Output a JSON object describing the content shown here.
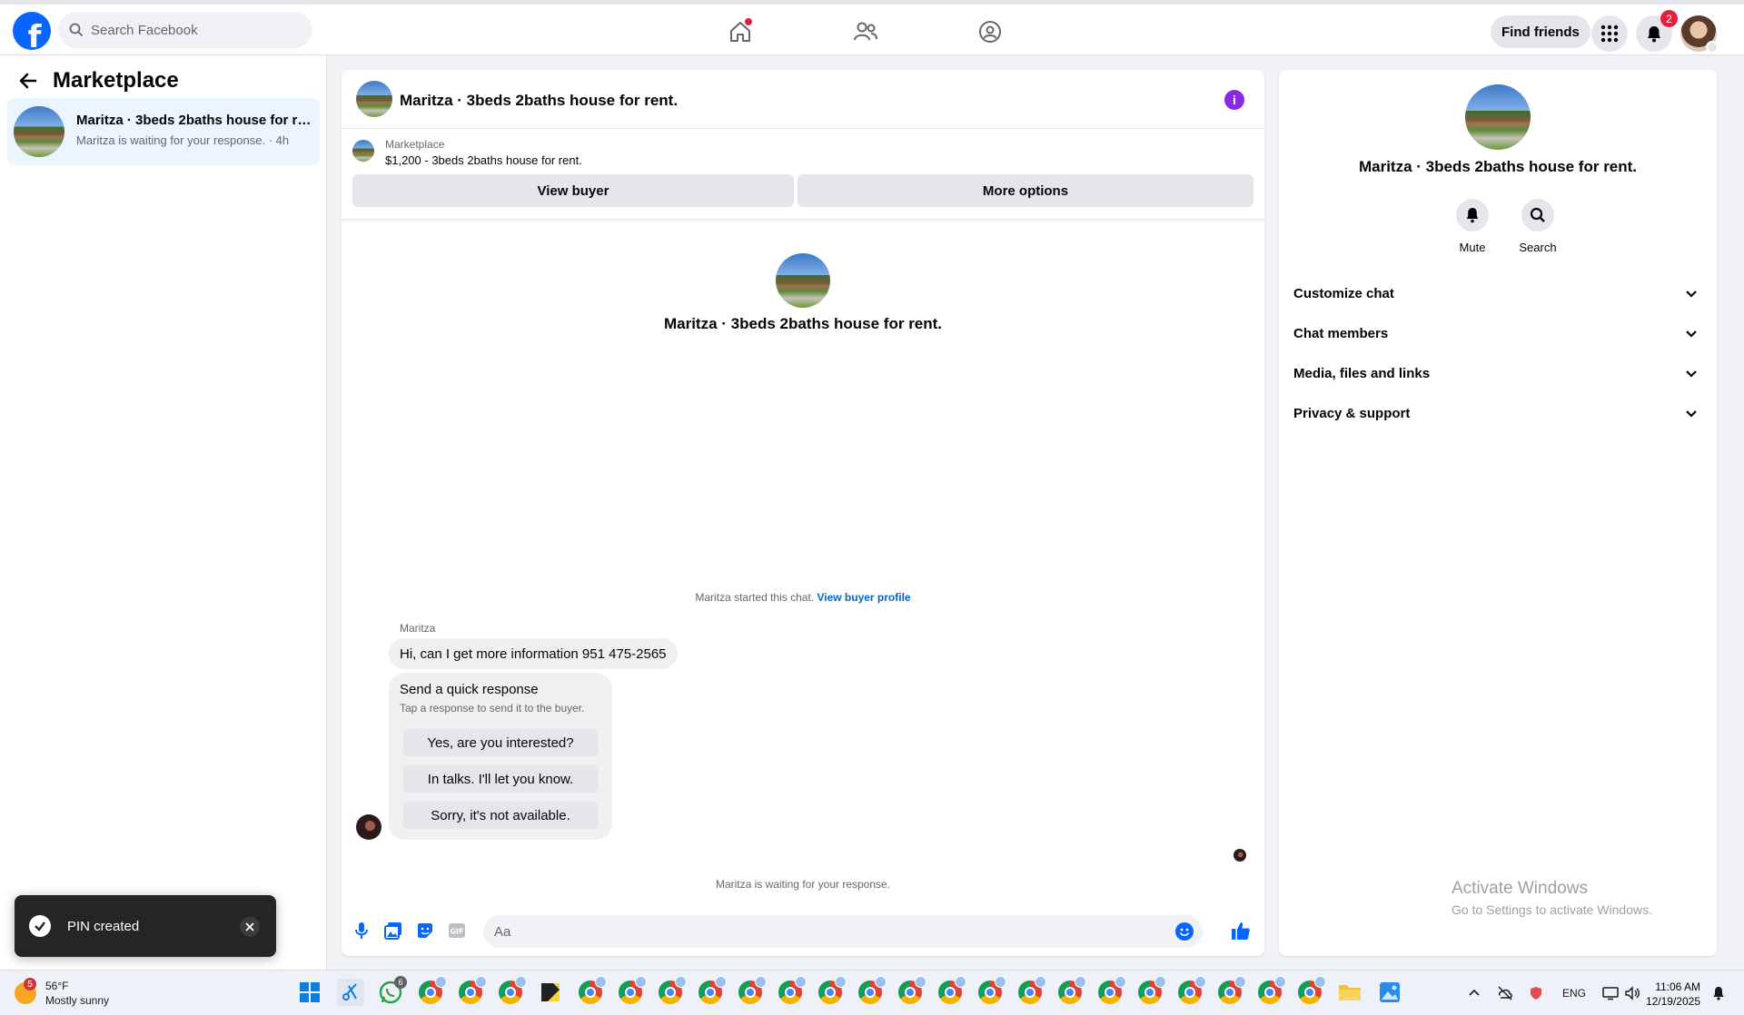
{
  "topbar": {
    "logo": "f",
    "search_placeholder": "Search Facebook",
    "find_friends": "Find friends",
    "notifications_count": "2",
    "nav_icons": [
      "home-icon",
      "friends-icon",
      "groups-icon"
    ]
  },
  "sidebar": {
    "title": "Marketplace",
    "threads": [
      {
        "title": "Maritza · 3beds 2baths house for rent.",
        "subtitle": "Maritza is waiting for your response. · 4h"
      }
    ]
  },
  "toast": {
    "message": "PIN created"
  },
  "chat": {
    "header_name": "Maritza · 3beds 2baths house for rent.",
    "marketplace": {
      "source": "Marketplace",
      "listing": "$1,200 - 3beds 2baths house for rent.",
      "view_buyer": "View buyer",
      "more_options": "More options"
    },
    "intro_name": "Maritza · 3beds 2baths house for rent.",
    "started_text": "Maritza started this chat.",
    "view_buyer_profile": "View buyer profile",
    "sender": "Maritza",
    "message": "Hi, can I get more information 951 475-2565",
    "quick_response": {
      "title": "Send a quick response",
      "subtitle": "Tap a response to send it to the buyer.",
      "options": [
        "Yes, are you interested?",
        "In talks. I'll let you know.",
        "Sorry, it's not available."
      ]
    },
    "waiting_text": "Maritza is waiting for your response.",
    "input_placeholder": "Aa"
  },
  "details": {
    "name": "Maritza · 3beds 2baths house for rent.",
    "actions": [
      "Mute",
      "Search"
    ],
    "sections": [
      "Customize chat",
      "Chat members",
      "Media, files and links",
      "Privacy & support"
    ]
  },
  "watermark": {
    "line1": "Activate Windows",
    "line2": "Go to Settings to activate Windows."
  },
  "taskbar": {
    "weather_badge": "5",
    "temperature": "56°F",
    "condition": "Mostly sunny",
    "whatsapp_badge": "6",
    "language": "ENG",
    "time": "11:06 AM",
    "date": "12/19/2025"
  },
  "colors": {
    "accent": "#0866ff",
    "selected_bg": "#ebf5ff",
    "badge": "#e41e3f",
    "info": "#8a2be2"
  }
}
